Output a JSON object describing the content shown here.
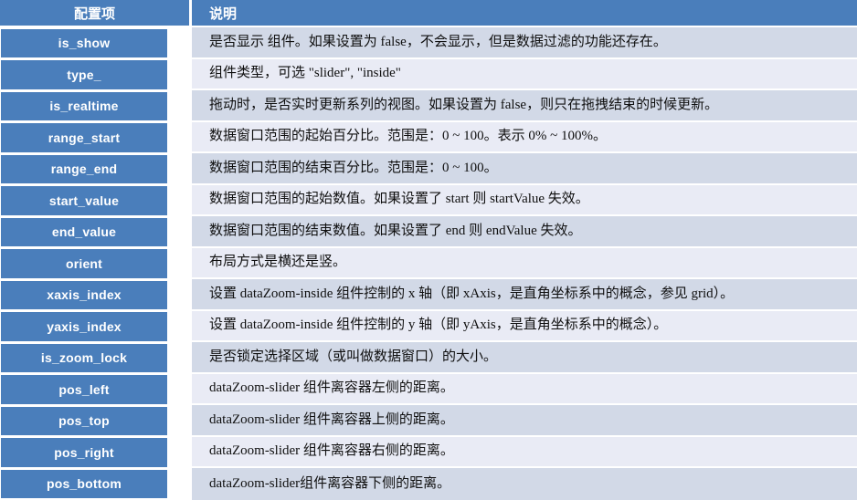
{
  "table": {
    "headers": {
      "key": "配置项",
      "description": "说明"
    },
    "rows": [
      {
        "key": "is_show",
        "description": "是否显示 组件。如果设置为 false，不会显示，但是数据过滤的功能还存在。"
      },
      {
        "key": "type_",
        "description": "组件类型，可选 \"slider\", \"inside\""
      },
      {
        "key": "is_realtime",
        "description": "拖动时，是否实时更新系列的视图。如果设置为 false，则只在拖拽结束的时候更新。"
      },
      {
        "key": "range_start",
        "description": "数据窗口范围的起始百分比。范围是：0 ~ 100。表示 0% ~ 100%。"
      },
      {
        "key": "range_end",
        "description": "数据窗口范围的结束百分比。范围是：0 ~ 100。"
      },
      {
        "key": "start_value",
        "description": "数据窗口范围的起始数值。如果设置了 start 则 startValue 失效。"
      },
      {
        "key": "end_value",
        "description": "数据窗口范围的结束数值。如果设置了 end 则 endValue 失效。"
      },
      {
        "key": "orient",
        "description": "布局方式是横还是竖。"
      },
      {
        "key": "xaxis_index",
        "description": "设置 dataZoom-inside 组件控制的 x 轴（即 xAxis，是直角坐标系中的概念，参见 grid）。"
      },
      {
        "key": "yaxis_index",
        "description": "设置 dataZoom-inside 组件控制的 y 轴（即 yAxis，是直角坐标系中的概念）。"
      },
      {
        "key": "is_zoom_lock",
        "description": "是否锁定选择区域（或叫做数据窗口）的大小。"
      },
      {
        "key": "pos_left",
        "description": "dataZoom-slider 组件离容器左侧的距离。"
      },
      {
        "key": "pos_top",
        "description": "dataZoom-slider 组件离容器上侧的距离。"
      },
      {
        "key": "pos_right",
        "description": "dataZoom-slider 组件离容器右侧的距离。"
      },
      {
        "key": "pos_bottom",
        "description": "dataZoom-slider组件离容器下侧的距离。"
      }
    ]
  },
  "colors": {
    "header_blue": "#4a7ebb",
    "chip_blue": "#4a7ebb",
    "row_odd": "#d2d9e7",
    "row_even": "#e9ebf5",
    "text_dark": "#0f0f0f",
    "bottom_rule": "#1b1b1b"
  }
}
